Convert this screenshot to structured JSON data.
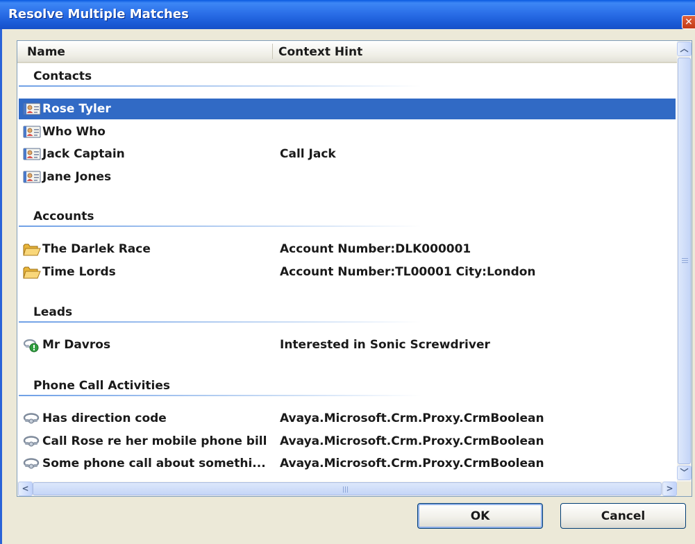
{
  "window": {
    "title": "Resolve Multiple Matches",
    "close_glyph": "✕"
  },
  "columns": {
    "name": "Name",
    "context_hint": "Context Hint"
  },
  "groups": [
    {
      "title": "Contacts",
      "icon": "contact-card-icon",
      "rows": [
        {
          "name": "Rose Tyler",
          "hint": "",
          "selected": true
        },
        {
          "name": "Who Who",
          "hint": ""
        },
        {
          "name": "Jack Captain",
          "hint": "Call Jack"
        },
        {
          "name": "Jane Jones",
          "hint": ""
        }
      ]
    },
    {
      "title": "Accounts",
      "icon": "folder-icon",
      "rows": [
        {
          "name": "The Darlek Race",
          "hint": "Account Number:DLK000001"
        },
        {
          "name": "Time Lords",
          "hint": "Account Number:TL00001 City:London"
        }
      ]
    },
    {
      "title": "Leads",
      "icon": "lead-icon",
      "rows": [
        {
          "name": "Mr Davros",
          "hint": "Interested in Sonic Screwdriver"
        }
      ]
    },
    {
      "title": "Phone Call Activities",
      "icon": "phone-call-icon",
      "rows": [
        {
          "name": "Has direction code",
          "hint": "Avaya.Microsoft.Crm.Proxy.CrmBoolean"
        },
        {
          "name": "Call Rose re her mobile phone bill",
          "hint": "Avaya.Microsoft.Crm.Proxy.CrmBoolean"
        },
        {
          "name": "Some phone call about somethi...",
          "hint": "Avaya.Microsoft.Crm.Proxy.CrmBoolean"
        }
      ]
    }
  ],
  "buttons": {
    "ok": "OK",
    "cancel": "Cancel"
  },
  "colors": {
    "selection": "#316ac5",
    "titlebar": "#2b6fe8",
    "group_line": "#6fa0e6"
  }
}
